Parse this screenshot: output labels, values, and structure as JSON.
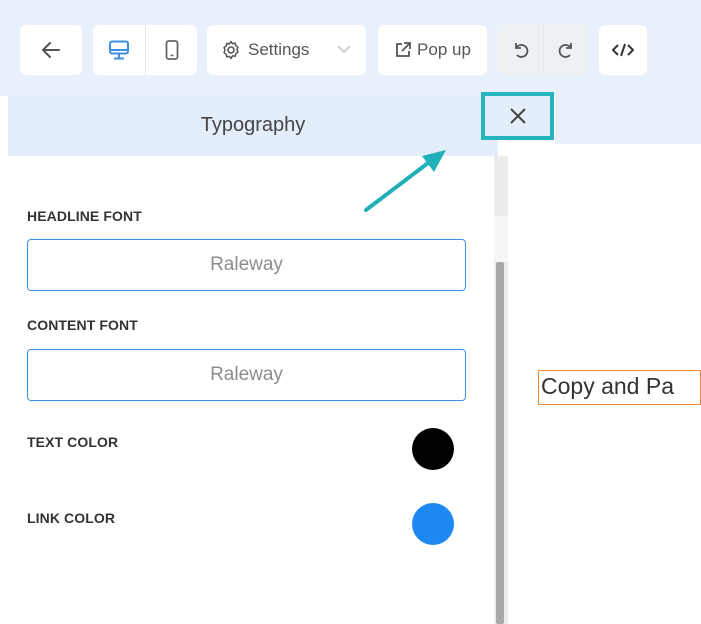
{
  "toolbar": {
    "settings_label": "Settings",
    "popup_label": "Pop up"
  },
  "panel": {
    "title": "Typography",
    "headline_font_label": "HEADLINE FONT",
    "headline_font_value": "Raleway",
    "content_font_label": "CONTENT FONT",
    "content_font_value": "Raleway",
    "text_color_label": "TEXT COLOR",
    "text_color": "#000000",
    "link_color_label": "LINK COLOR",
    "link_color": "#1e88f0"
  },
  "preview": {
    "text": "Copy and Pa"
  },
  "icons": [
    "back-arrow-icon",
    "desktop-icon",
    "mobile-icon",
    "gear-icon",
    "chevron-down-icon",
    "external-link-icon",
    "undo-icon",
    "redo-icon",
    "code-icon",
    "close-icon"
  ],
  "colors": {
    "toolbar_bg": "#e8f1fb",
    "accent_blue": "#3d8fe6",
    "highlight_teal": "#26b5bd",
    "preview_outline": "#f08a36"
  }
}
